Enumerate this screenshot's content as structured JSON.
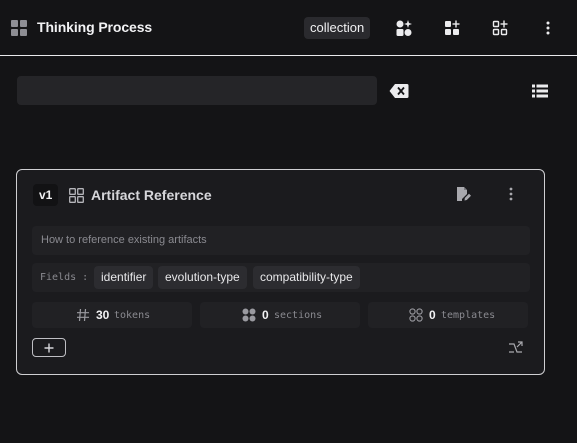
{
  "header": {
    "title": "Thinking Process",
    "collection_label": "collection",
    "icons": [
      "layout-grid-icon",
      "sparkle-shapes-icon",
      "add-grid-icon",
      "add-grid-outline-icon",
      "more-vertical-icon"
    ]
  },
  "search": {
    "value": "",
    "placeholder": "",
    "clear_icon": "backspace-icon",
    "view_icon": "list-view-icon"
  },
  "card": {
    "version": "v1",
    "title": "Artifact Reference",
    "description": "How to reference existing artifacts",
    "fields_label": "Fields :",
    "fields": [
      "identifier",
      "evolution-type",
      "compatibility-type"
    ],
    "stats": [
      {
        "icon": "hash-icon",
        "value": "30",
        "label": "tokens"
      },
      {
        "icon": "filled-dots-icon",
        "value": "0",
        "label": "sections"
      },
      {
        "icon": "outline-dots-icon",
        "value": "0",
        "label": "templates"
      }
    ]
  },
  "colors": {
    "background": "#141416",
    "card": "#1b1b1e",
    "panel": "#212124",
    "chip": "#2c2c30",
    "border": "#cfcfd2",
    "text": "#f2f2f4",
    "muted": "#8a8a90"
  }
}
